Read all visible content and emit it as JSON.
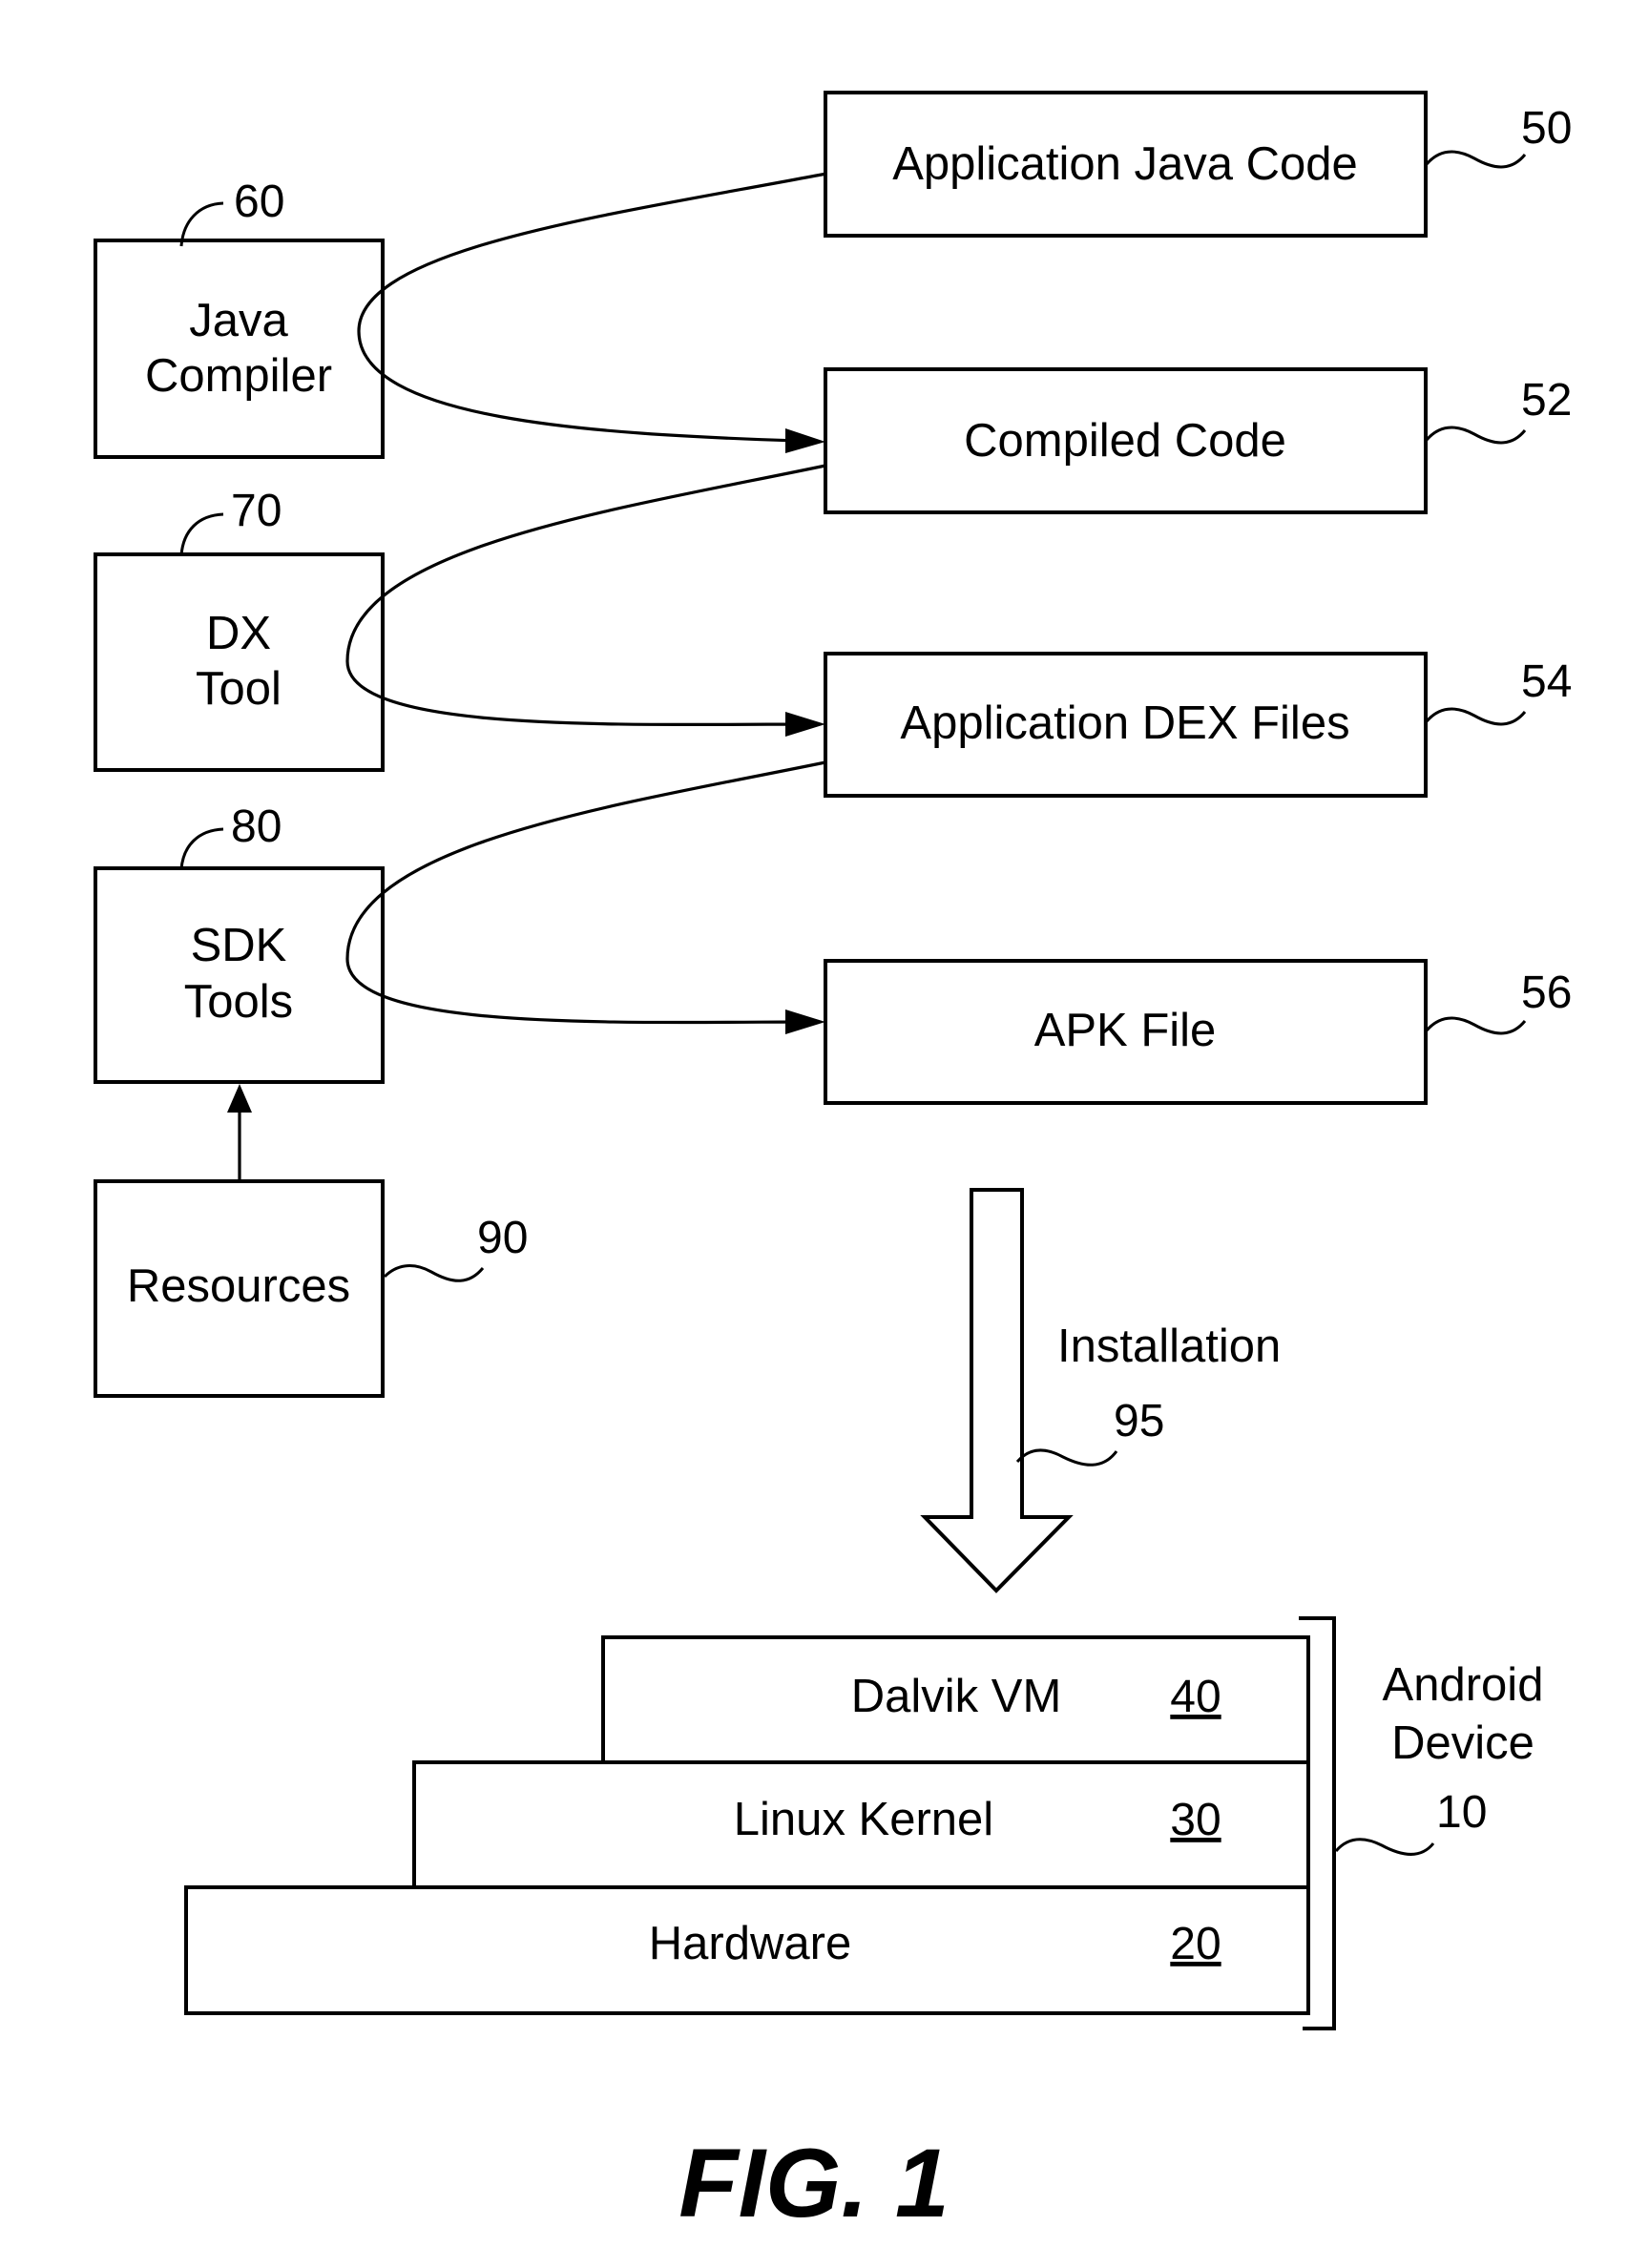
{
  "figure": {
    "caption": "FIG. 1",
    "colors": {
      "stroke": "#000000",
      "background": "#ffffff"
    }
  },
  "tools": [
    {
      "id": "java-compiler",
      "lines": [
        "Java",
        "Compiler"
      ],
      "ref": "60"
    },
    {
      "id": "dx-tool",
      "lines": [
        "DX",
        "Tool"
      ],
      "ref": "70"
    },
    {
      "id": "sdk-tools",
      "lines": [
        "SDK",
        "Tools"
      ],
      "ref": "80"
    },
    {
      "id": "resources",
      "lines": [
        "Resources"
      ],
      "ref": "90"
    }
  ],
  "artifacts": [
    {
      "id": "application-java-code",
      "label": "Application Java Code",
      "ref": "50"
    },
    {
      "id": "compiled-code",
      "label": "Compiled Code",
      "ref": "52"
    },
    {
      "id": "application-dex-files",
      "label": "Application DEX Files",
      "ref": "54"
    },
    {
      "id": "apk-file",
      "label": "APK File",
      "ref": "56"
    }
  ],
  "flows": [
    {
      "from": "Application Java Code",
      "via": "Java Compiler",
      "to": "Compiled Code"
    },
    {
      "from": "Compiled Code",
      "via": "DX Tool",
      "to": "Application DEX Files"
    },
    {
      "from": "Application DEX Files",
      "via": "SDK Tools",
      "to": "APK File"
    },
    {
      "from": "Resources",
      "to": "SDK Tools"
    }
  ],
  "installation": {
    "label": "Installation",
    "ref": "95"
  },
  "device": {
    "lines": [
      "Android",
      "Device"
    ],
    "ref": "10",
    "layers": [
      {
        "id": "dalvik-vm",
        "label": "Dalvik VM",
        "ref": "40"
      },
      {
        "id": "linux-kernel",
        "label": "Linux Kernel",
        "ref": "30"
      },
      {
        "id": "hardware",
        "label": "Hardware",
        "ref": "20"
      }
    ]
  }
}
